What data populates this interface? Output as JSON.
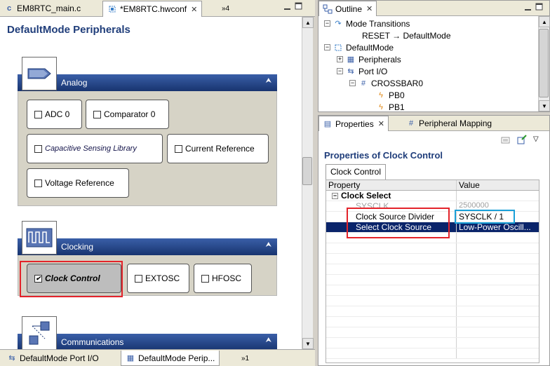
{
  "editor_tabs": [
    {
      "label": "EM8RTC_main.c"
    },
    {
      "label": "*EM8RTC.hwconf"
    },
    {
      "label": "»4"
    }
  ],
  "editor": {
    "title": "DefaultMode Peripherals",
    "sections": {
      "analog": {
        "label": "Analog",
        "buttons": [
          "ADC 0",
          "Comparator 0",
          "Capacitive Sensing Library",
          "Current Reference",
          "Voltage Reference"
        ]
      },
      "clocking": {
        "label": "Clocking",
        "buttons": [
          "Clock Control",
          "EXTOSC",
          "HFOSC"
        ]
      },
      "communications": {
        "label": "Communications"
      }
    }
  },
  "bottom_tabs": [
    {
      "label": "DefaultMode Port I/O"
    },
    {
      "label": "DefaultMode Perip..."
    },
    {
      "label": "»1"
    }
  ],
  "outline": {
    "tab_label": "Outline",
    "items": [
      {
        "label": "Mode Transitions"
      },
      {
        "label": "RESET → DefaultMode"
      },
      {
        "label": "DefaultMode"
      },
      {
        "label": "Peripherals"
      },
      {
        "label": "Port I/O"
      },
      {
        "label": "CROSSBAR0"
      },
      {
        "label": "PB0"
      },
      {
        "label": "PB1"
      }
    ]
  },
  "properties": {
    "tab_label": "Properties",
    "mapping_tab_label": "Peripheral Mapping",
    "title": "Properties of Clock Control",
    "sub_tab": "Clock Control",
    "col_property": "Property",
    "col_value": "Value",
    "rows": [
      {
        "property": "Clock Select",
        "value": ""
      },
      {
        "property": "SYSCLK",
        "value": "2500000"
      },
      {
        "property": "Clock Source Divider",
        "value": "SYSCLK / 1"
      },
      {
        "property": "Select Clock Source",
        "value": "Low-Power Oscill..."
      }
    ]
  },
  "colors": {
    "section_bar": "#18346f",
    "annotation_red": "#e3232a",
    "annotation_blue": "#1aa0d8",
    "selection": "#0a246a"
  }
}
